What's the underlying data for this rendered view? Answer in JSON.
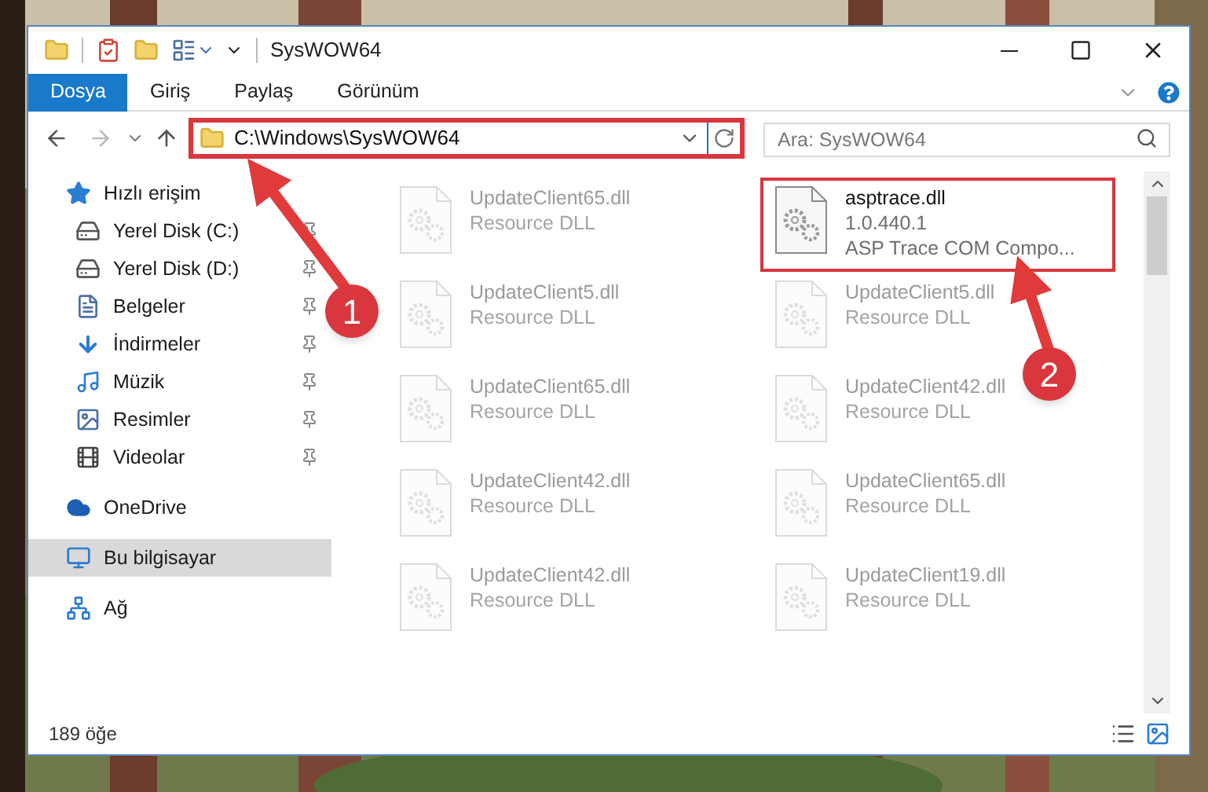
{
  "window": {
    "title": "SysWOW64"
  },
  "ribbon_tabs": [
    {
      "label": "Dosya",
      "selected": true
    },
    {
      "label": "Giriş",
      "selected": false
    },
    {
      "label": "Paylaş",
      "selected": false
    },
    {
      "label": "Görünüm",
      "selected": false
    }
  ],
  "address": {
    "path": "C:\\Windows\\SysWOW64"
  },
  "search": {
    "placeholder": "Ara: SysWOW64"
  },
  "sidebar": {
    "items": [
      {
        "kind": "star",
        "label": "Hızlı erişim",
        "selected": false,
        "children": [
          {
            "kind": "disk-c",
            "label": "Yerel Disk (C:)",
            "pinned": true
          },
          {
            "kind": "disk",
            "label": "Yerel Disk (D:)",
            "pinned": true
          },
          {
            "kind": "document",
            "label": "Belgeler",
            "pinned": true
          },
          {
            "kind": "download",
            "label": "İndirmeler",
            "pinned": true
          },
          {
            "kind": "music",
            "label": "Müzik",
            "pinned": true
          },
          {
            "label": "Resimler",
            "pinned": true
          },
          {
            "kind": "video",
            "label": "Videolar",
            "pinned": true
          }
        ]
      },
      {
        "kind": "cloud",
        "label": "OneDrive",
        "selected": false
      },
      {
        "kind": "computer",
        "label": "Bu bilgisayar",
        "selected": true
      },
      {
        "kind": "network",
        "label": "Ağ",
        "selected": false
      }
    ]
  },
  "files": [
    {
      "name": "UpdateClient65.dll",
      "lines": [
        "Resource DLL"
      ],
      "faded": true
    },
    {
      "name": "asptrace.dll",
      "lines": [
        "1.0.440.1",
        "ASP Trace COM Compo..."
      ],
      "faded": false
    },
    {
      "name": "UpdateClient5.dll",
      "lines": [
        "Resource DLL"
      ],
      "faded": true
    },
    {
      "name": "UpdateClient5.dll",
      "lines": [
        "Resource DLL"
      ],
      "faded": true
    },
    {
      "name": "UpdateClient65.dll",
      "lines": [
        "Resource DLL"
      ],
      "faded": true
    },
    {
      "name": "UpdateClient42.dll",
      "lines": [
        "Resource DLL"
      ],
      "faded": true
    },
    {
      "name": "UpdateClient42.dll",
      "lines": [
        "Resource DLL"
      ],
      "faded": true
    },
    {
      "name": "UpdateClient65.dll",
      "lines": [
        "Resource DLL"
      ],
      "faded": true
    },
    {
      "name": "UpdateClient42.dll",
      "lines": [
        "Resource DLL"
      ],
      "faded": true
    },
    {
      "name": "UpdateClient19.dll",
      "lines": [
        "Resource DLL"
      ],
      "faded": true
    }
  ],
  "status_bar": {
    "count": "189 öğe"
  },
  "callouts": [
    {
      "number": "1"
    },
    {
      "number": "2"
    }
  ]
}
